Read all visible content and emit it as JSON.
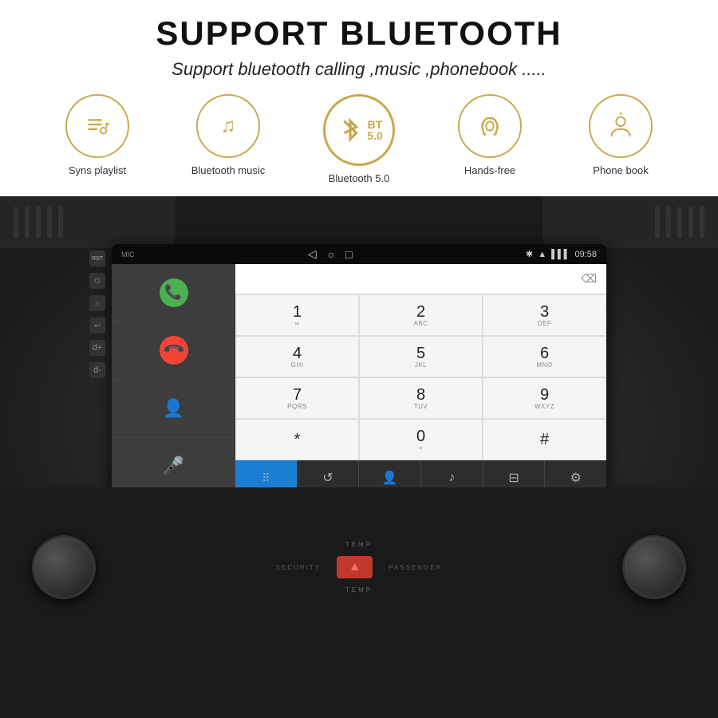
{
  "header": {
    "title": "SUPPORT BLUETOOTH",
    "subtitle": "Support bluetooth calling ,music ,phonebook ....."
  },
  "features": [
    {
      "id": "syns-playlist",
      "label": "Syns playlist",
      "icon": "music-note"
    },
    {
      "id": "bluetooth-music",
      "label": "Bluetooth music",
      "icon": "music-notes"
    },
    {
      "id": "bluetooth-50",
      "label": "Bluetooth 5.0",
      "icon": "bluetooth"
    },
    {
      "id": "hands-free",
      "label": "Hands-free",
      "icon": "phone"
    },
    {
      "id": "phone-book",
      "label": "Phone book",
      "icon": "contact"
    }
  ],
  "phone_ui": {
    "time": "09:58",
    "dialpad": [
      {
        "num": "1",
        "letters": "∞"
      },
      {
        "num": "2",
        "letters": "ABC"
      },
      {
        "num": "3",
        "letters": "DEF"
      },
      {
        "num": "4",
        "letters": "GHI"
      },
      {
        "num": "5",
        "letters": "JKL"
      },
      {
        "num": "6",
        "letters": "MNO"
      },
      {
        "num": "7",
        "letters": "PQRS"
      },
      {
        "num": "8",
        "letters": "TUV"
      },
      {
        "num": "9",
        "letters": "WXYZ"
      },
      {
        "num": "*",
        "letters": ""
      },
      {
        "num": "0",
        "letters": "+"
      },
      {
        "num": "#",
        "letters": ""
      }
    ]
  },
  "colors": {
    "gold": "#c9a84c",
    "green_call": "#4caf50",
    "red_end": "#f44336",
    "blue_active": "#1a7fd4"
  }
}
